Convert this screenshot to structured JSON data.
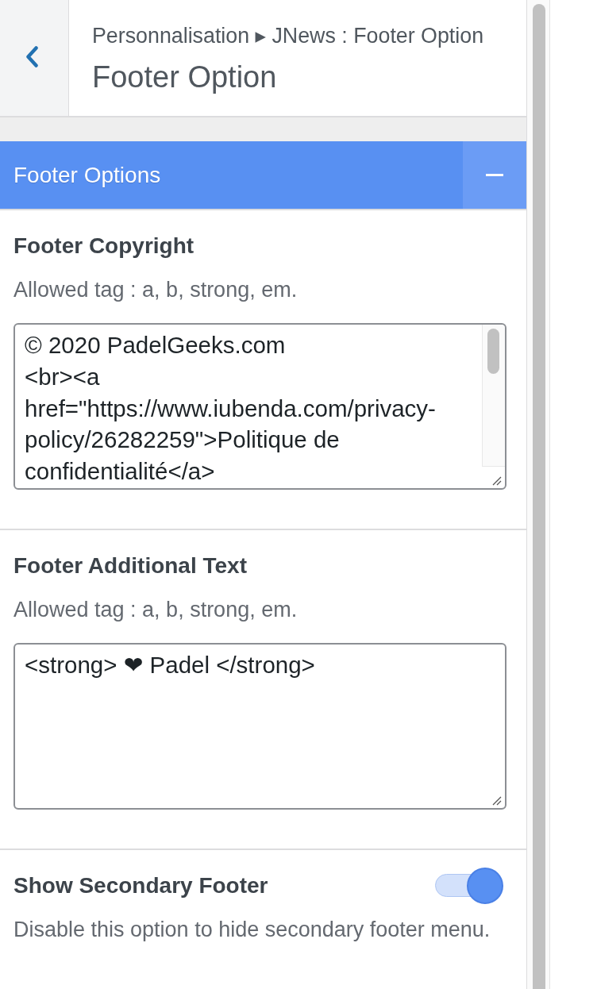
{
  "header": {
    "breadcrumb": "Personnalisation ▸ JNews : Footer Option",
    "title": "Footer Option"
  },
  "panel": {
    "title": "Footer Options",
    "expanded": true
  },
  "controls": [
    {
      "kind": "textarea",
      "label": "Footer Copyright",
      "description": "Allowed tag : a, b, strong, em.",
      "lines": [
        "© 2020 PadelGeeks.com",
        "<br><a",
        "href=\"https://www.iubenda.com/privacy-",
        "policy/26282259\">Politique de",
        "confidentialité</a>"
      ],
      "scrollable": true
    },
    {
      "kind": "textarea",
      "label": "Footer Additional Text",
      "description": "Allowed tag : a, b, strong, em.",
      "lines": [
        "<strong> ❤ Padel </strong>"
      ],
      "scrollable": false
    },
    {
      "kind": "toggle",
      "label": "Show Secondary Footer",
      "description": "Disable this option to hide secondary footer menu.",
      "on": true
    }
  ]
}
